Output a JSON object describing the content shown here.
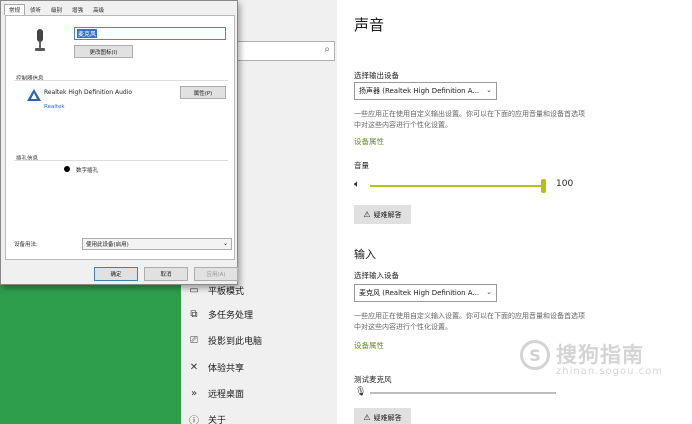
{
  "dialog": {
    "tabs": [
      "常规",
      "侦听",
      "级别",
      "增强",
      "高级"
    ],
    "device_name": "麦克风",
    "change_icon_label": "更改图标(I)",
    "controller_section_label": "控制器信息",
    "controller_name": "Realtek High Definition Audio",
    "controller_vendor": "Realtek",
    "properties_button": "属性(P)",
    "jack_section_label": "插孔信息",
    "jack_text": "数字插孔",
    "device_usage_label": "设备用法:",
    "device_usage_value": "使用此设备(启用)",
    "ok_button": "确定",
    "cancel_button": "取消",
    "apply_button": "应用(A)"
  },
  "nav": {
    "items": [
      {
        "icon": "tablet-icon",
        "label": "平板模式"
      },
      {
        "icon": "multitask-icon",
        "label": "多任务处理"
      },
      {
        "icon": "project-icon",
        "label": "投影到此电脑"
      },
      {
        "icon": "share-icon",
        "label": "体验共享"
      },
      {
        "icon": "remote-icon",
        "label": "远程桌面"
      },
      {
        "icon": "info-icon",
        "label": "关于"
      }
    ]
  },
  "sound": {
    "title": "声音",
    "output": {
      "select_label": "选择输出设备",
      "device": "扬声器 (Realtek High Definition A...",
      "description": "一些应用正在使用自定义输出设置。你可以在下面的应用音量和设备首选项中对这些内容进行个性化设置。",
      "properties_link": "设备属性",
      "volume_label": "音量",
      "volume_value": "100",
      "volume_level": 100,
      "troubleshoot_label": "疑难解答"
    },
    "input": {
      "section_title": "输入",
      "select_label": "选择输入设备",
      "device": "麦克风 (Realtek High Definition A...",
      "description": "一些应用正在使用自定义输入设置。你可以在下面的应用音量和设备首选项中对这些内容进行个性化设置。",
      "properties_link": "设备属性",
      "test_label": "测试麦克风",
      "test_level": 0,
      "troubleshoot_label": "疑难解答"
    }
  },
  "watermark": {
    "logo_char": "S",
    "text": "搜狗指南",
    "url": "zhinan.sogou.com"
  },
  "colors": {
    "accent": "#b5c020",
    "desktop_green": "#2e9e4a",
    "link": "#6b8e23"
  }
}
